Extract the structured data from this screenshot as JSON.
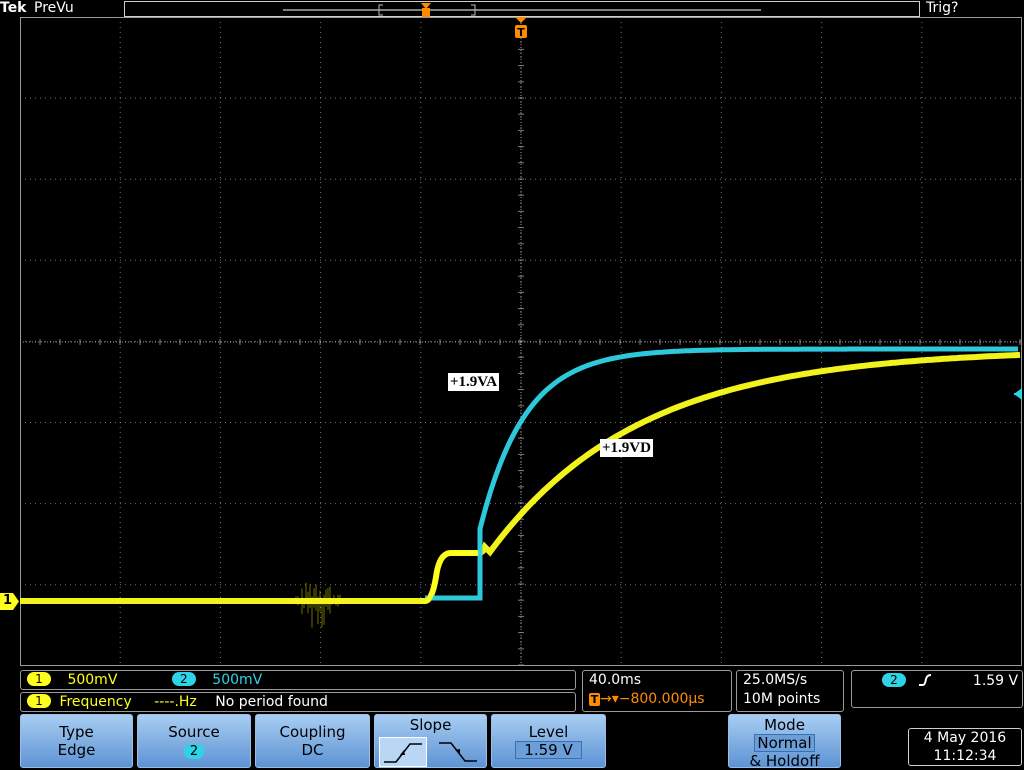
{
  "header": {
    "brand": "Tek",
    "mode": "PreVu",
    "trigger_status": "Trig?"
  },
  "markers": {
    "trigger": "T",
    "channel1": "1"
  },
  "waveform_labels": {
    "ch2_label": "+1.9VA",
    "ch1_label": "+1.9VD"
  },
  "colors": {
    "ch1": "#ffff1e",
    "ch2": "#2fd3e6",
    "trigger": "#ff8c00"
  },
  "readouts": {
    "ch1_badge": "1",
    "ch1_scale": "500mV",
    "ch2_badge": "2",
    "ch2_scale": "500mV",
    "freq_badge": "1",
    "freq_label": "Frequency",
    "freq_value": "----.Hz",
    "freq_status": "No period found",
    "timebase": "40.0ms",
    "trigger_delay": "→▾−800.000µs",
    "sample_rate": "25.0MS/s",
    "record_length": "10M points",
    "trig_source_badge": "2",
    "trig_slope_icon": "rising-edge-icon",
    "trig_level": "1.59 V"
  },
  "menu": {
    "type_label": "Type",
    "type_value": "Edge",
    "source_label": "Source",
    "source_value": "2",
    "coupling_label": "Coupling",
    "coupling_value": "DC",
    "slope_label": "Slope",
    "level_label": "Level",
    "level_value": "1.59 V",
    "mode_label": "Mode",
    "mode_value": "Normal",
    "mode_extra": "& Holdoff"
  },
  "datetime": {
    "date": "4 May 2016",
    "time": "11:12:34"
  }
}
